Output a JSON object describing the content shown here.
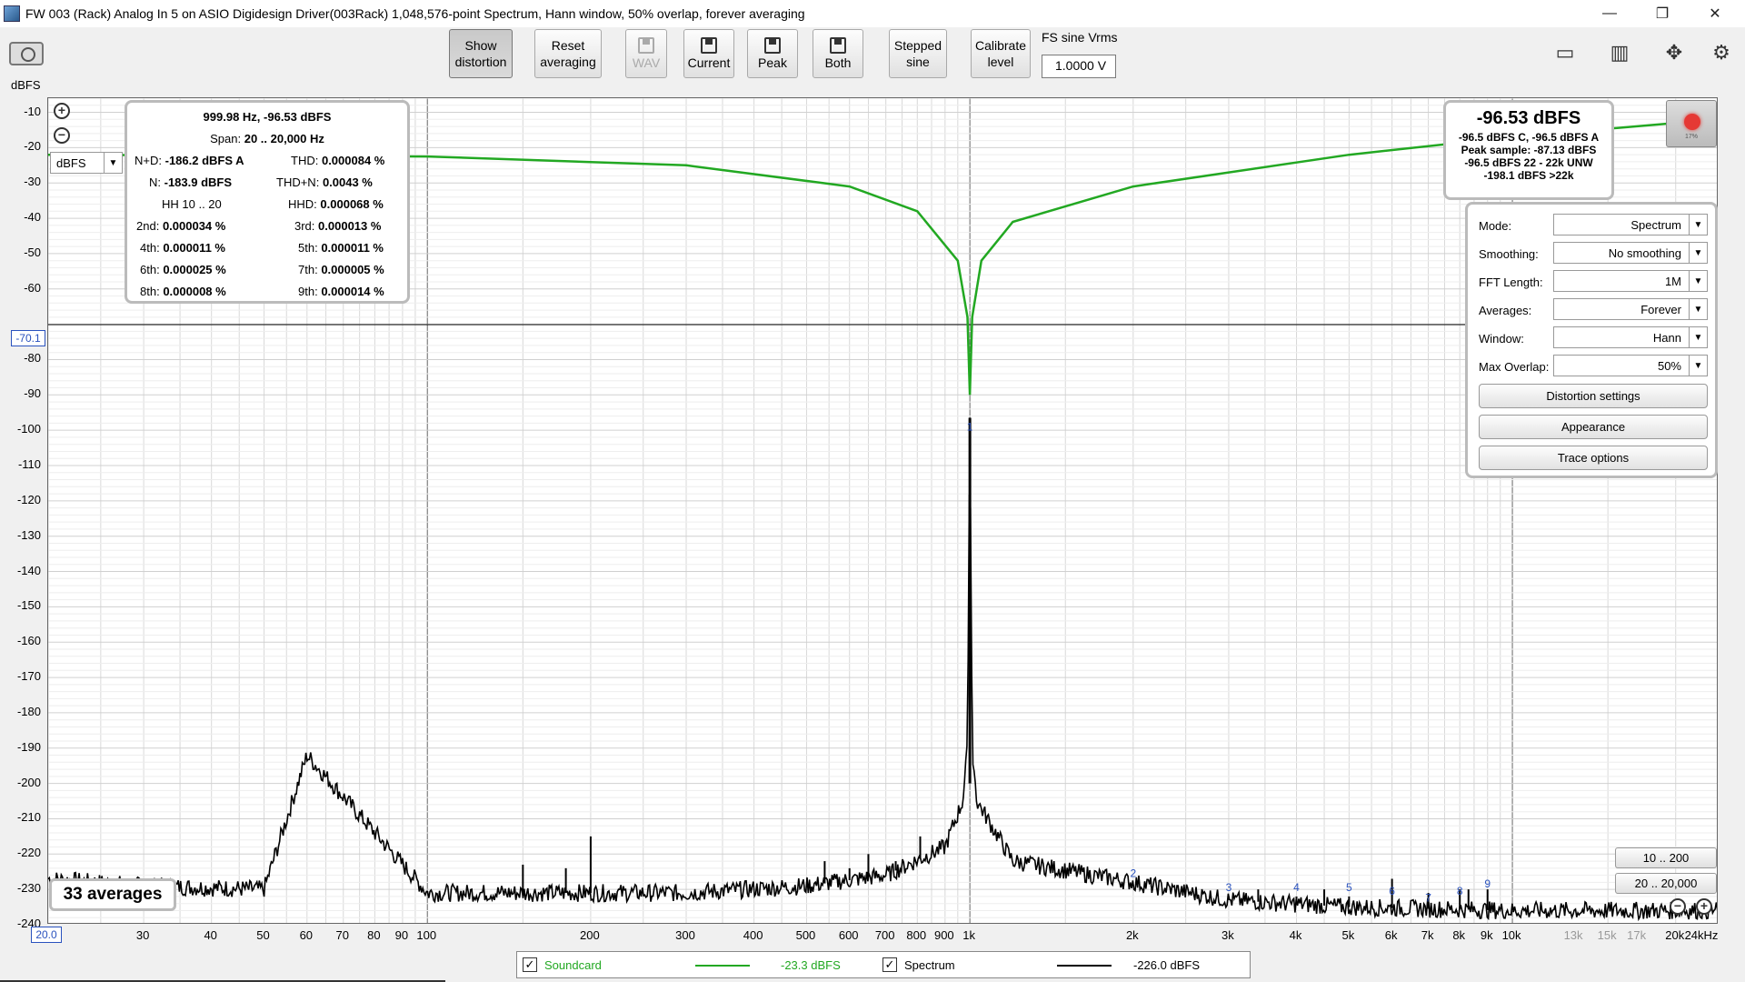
{
  "window": {
    "title": "FW 003 (Rack) Analog In 5 on ASIO Digidesign Driver(003Rack) 1,048,576-point Spectrum, Hann window, 50% overlap, forever averaging",
    "minimize": "—",
    "maximize": "❐",
    "close": "✕"
  },
  "toolbar": {
    "show_distortion": [
      "Show",
      "distortion"
    ],
    "reset_averaging": [
      "Reset",
      "averaging"
    ],
    "wav": "WAV",
    "current": "Current",
    "peak": "Peak",
    "both": "Both",
    "stepped_sine": [
      "Stepped",
      "sine"
    ],
    "calibrate_level": [
      "Calibrate",
      "level"
    ],
    "fs_label": "FS sine Vrms",
    "fs_value": "1.0000 V"
  },
  "plot": {
    "y_unit": "dBFS",
    "unit_select": "dBFS",
    "cursor_y": "-70.1",
    "x_start": "20.0",
    "y_ticks": [
      "-10",
      "-20",
      "-30",
      "-40",
      "-50",
      "-60",
      "-70",
      "-80",
      "-90",
      "-100",
      "-110",
      "-120",
      "-130",
      "-140",
      "-150",
      "-160",
      "-170",
      "-180",
      "-190",
      "-200",
      "-210",
      "-220",
      "-230",
      "-240"
    ],
    "x_ticks": [
      "30",
      "40",
      "50",
      "60",
      "70",
      "80",
      "90",
      "100",
      "200",
      "300",
      "400",
      "500",
      "600",
      "700",
      "800",
      "900",
      "1k",
      "2k",
      "3k",
      "4k",
      "5k",
      "6k",
      "7k",
      "8k",
      "9k",
      "10k",
      "13k",
      "15k",
      "17k",
      "20k",
      "24kHz"
    ],
    "harmonic_labels": [
      "1",
      "2",
      "3",
      "4",
      "5",
      "6",
      "7",
      "8",
      "9"
    ]
  },
  "distortion": {
    "header": "999.98 Hz, -96.53 dBFS",
    "span_label": "Span:",
    "span_value": "20 .. 20,000 Hz",
    "nd_label": "N+D:",
    "nd_value": "-186.2 dBFS A",
    "thd_label": "THD:",
    "thd_value": "0.000084 %",
    "n_label": "N:",
    "n_value": "-183.9 dBFS",
    "thdn_label": "THD+N:",
    "thdn_value": "0.0043 %",
    "hh_label": "HH 10 .. 20",
    "hhd_label": "HHD:",
    "hhd_value": "0.000068 %",
    "h2_label": "2nd:",
    "h2_value": "0.000034 %",
    "h3_label": "3rd:",
    "h3_value": "0.000013 %",
    "h4_label": "4th:",
    "h4_value": "0.000011 %",
    "h5_label": "5th:",
    "h5_value": "0.000011 %",
    "h6_label": "6th:",
    "h6_value": "0.000025 %",
    "h7_label": "7th:",
    "h7_value": "0.000005 %",
    "h8_label": "8th:",
    "h8_value": "0.000008 %",
    "h9_label": "9th:",
    "h9_value": "0.000014 %"
  },
  "peak": {
    "main": "-96.53 dBFS",
    "line1": "-96.5 dBFS C, -96.5 dBFS A",
    "line2": "Peak sample: -87.13 dBFS",
    "line3": "-96.5 dBFS 22 - 22k UNW",
    "line4": "-198.1 dBFS >22k",
    "record_pct": "17%"
  },
  "settings": {
    "mode_label": "Mode:",
    "mode_value": "Spectrum",
    "smoothing_label": "Smoothing:",
    "smoothing_value": "No  smoothing",
    "fft_label": "FFT Length:",
    "fft_value": "1M",
    "averages_label": "Averages:",
    "averages_value": "Forever",
    "window_label": "Window:",
    "window_value": "Hann",
    "overlap_label": "Max Overlap:",
    "overlap_value": "50%",
    "distortion_settings": "Distortion settings",
    "appearance": "Appearance",
    "trace_options": "Trace options"
  },
  "averages_badge": "33 averages",
  "ranges": {
    "r1": "10 .. 200",
    "r2": "20 .. 20,000"
  },
  "legend": {
    "soundcard_label": "Soundcard",
    "soundcard_value": "-23.3 dBFS",
    "spectrum_label": "Spectrum",
    "spectrum_value": "-226.0 dBFS",
    "check": "✓"
  },
  "colors": {
    "soundcard": "#22a822",
    "spectrum": "#000000",
    "accent_blue": "#2a52be"
  },
  "chart_data": {
    "type": "line",
    "xlabel": "",
    "ylabel": "dBFS",
    "xscale": "log",
    "xlim": [
      20,
      24000
    ],
    "ylim": [
      -240,
      0
    ],
    "grid": true,
    "series": [
      {
        "name": "Soundcard",
        "note_color": "#22a822",
        "x": [
          20,
          100,
          300,
          600,
          800,
          950,
          990,
          999.98,
          1010,
          1050,
          1200,
          2000,
          5000,
          10000,
          20000,
          24000
        ],
        "values": [
          -22,
          -22.5,
          -25,
          -31,
          -38,
          -52,
          -68,
          -90,
          -68,
          -52,
          -41,
          -31,
          -22,
          -17,
          -13,
          -11
        ]
      },
      {
        "name": "Spectrum",
        "x": [
          20,
          30,
          50,
          60,
          100,
          150,
          200,
          300,
          500,
          700,
          900,
          970,
          990,
          999.98,
          1010,
          1030,
          1200,
          2000,
          3000,
          5000,
          10000,
          20000,
          24000
        ],
        "values": [
          -227,
          -229,
          -230,
          -192,
          -231,
          -231,
          -231,
          -231,
          -229,
          -226,
          -218,
          -205,
          -190,
          -96.5,
          -190,
          -205,
          -222,
          -228,
          -233,
          -235,
          -236,
          -236,
          -236
        ],
        "spikes": [
          {
            "x": 60,
            "y": -192
          },
          {
            "x": 150,
            "y": -223
          },
          {
            "x": 180,
            "y": -224
          },
          {
            "x": 200,
            "y": -215
          },
          {
            "x": 540,
            "y": -222
          },
          {
            "x": 600,
            "y": -224
          },
          {
            "x": 650,
            "y": -220
          },
          {
            "x": 730,
            "y": -222
          },
          {
            "x": 810,
            "y": -215
          },
          {
            "x": 2000,
            "y": -228
          },
          {
            "x": 2150,
            "y": -229
          },
          {
            "x": 3000,
            "y": -232
          },
          {
            "x": 3400,
            "y": -230
          },
          {
            "x": 4000,
            "y": -232
          },
          {
            "x": 4500,
            "y": -230
          },
          {
            "x": 5000,
            "y": -232
          },
          {
            "x": 6000,
            "y": -227
          },
          {
            "x": 7000,
            "y": -231
          },
          {
            "x": 8000,
            "y": -230
          },
          {
            "x": 8300,
            "y": -230
          },
          {
            "x": 9000,
            "y": -230
          }
        ]
      }
    ],
    "harmonics": [
      {
        "label": "1",
        "x": 1000,
        "y": -96.5
      },
      {
        "label": "2",
        "x": 2000,
        "y": -228
      },
      {
        "label": "3",
        "x": 3000,
        "y": -232
      },
      {
        "label": "4",
        "x": 4000,
        "y": -232
      },
      {
        "label": "5",
        "x": 5000,
        "y": -232
      },
      {
        "label": "6",
        "x": 6000,
        "y": -233
      },
      {
        "label": "7",
        "x": 7000,
        "y": -235
      },
      {
        "label": "8",
        "x": 8000,
        "y": -233
      },
      {
        "label": "9",
        "x": 9000,
        "y": -231
      }
    ],
    "cursor_y": -70.1
  }
}
